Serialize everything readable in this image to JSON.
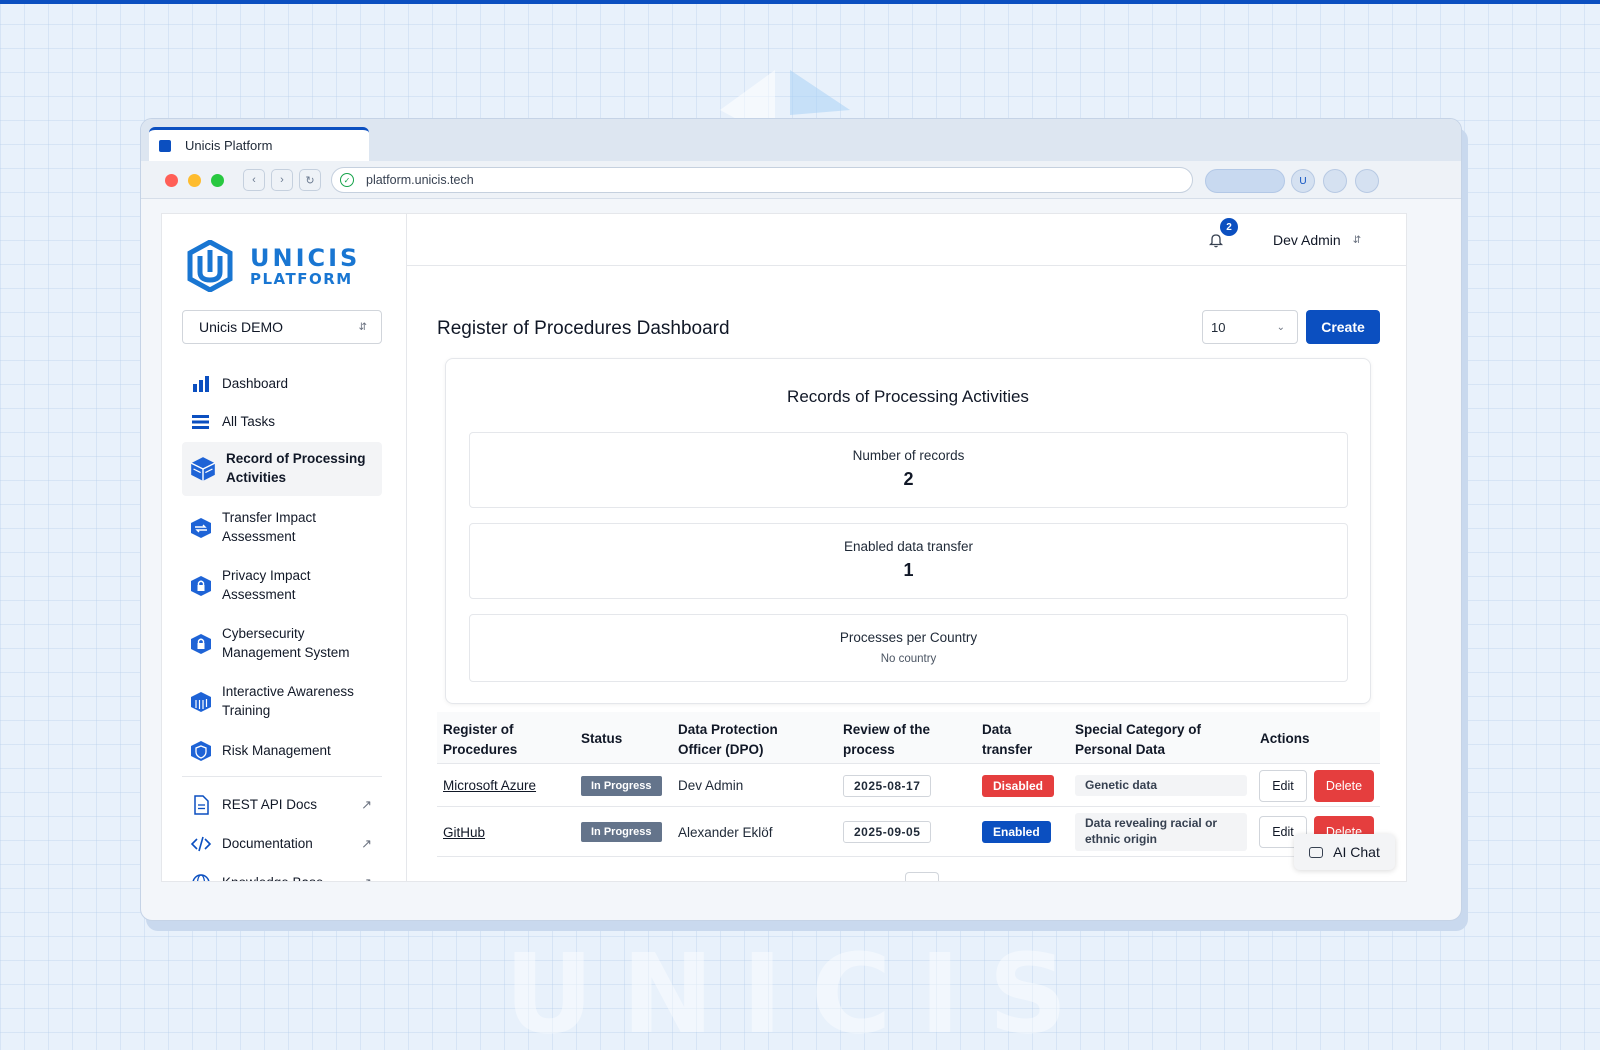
{
  "browser": {
    "tab_title": "Unicis Platform",
    "url": "platform.unicis.tech",
    "profile_initial": "U"
  },
  "background": {
    "watermark": "UNICIS"
  },
  "sidebar": {
    "logo_line1": "UNICIS",
    "logo_line2": "PLATFORM",
    "org_select": "Unicis DEMO",
    "items": [
      {
        "label": "Dashboard",
        "icon": "bar-chart-icon"
      },
      {
        "label": "All Tasks",
        "icon": "list-icon"
      },
      {
        "label": "Record of Processing Activities",
        "icon": "cube-stack-icon",
        "active": true
      },
      {
        "label": "Transfer Impact Assessment",
        "icon": "transfer-cube-icon"
      },
      {
        "label": "Privacy Impact Assessment",
        "icon": "lock-hexagon-icon"
      },
      {
        "label": "Cybersecurity Management System",
        "icon": "lock-hexagon-icon"
      },
      {
        "label": "Interactive Awareness Training",
        "icon": "building-cube-icon"
      },
      {
        "label": "Risk Management",
        "icon": "shield-hexagon-icon"
      }
    ],
    "external_links": [
      {
        "label": "REST API Docs",
        "icon": "document-icon"
      },
      {
        "label": "Documentation",
        "icon": "code-icon"
      },
      {
        "label": "Knowledge Base",
        "icon": "globe-icon"
      }
    ]
  },
  "header": {
    "notification_count": "2",
    "user_name": "Dev Admin"
  },
  "main": {
    "title": "Register of Procedures Dashboard",
    "page_size": "10",
    "create_label": "Create",
    "card_title": "Records of Processing Activities",
    "stats": [
      {
        "label": "Number of records",
        "value": "2"
      },
      {
        "label": "Enabled data transfer",
        "value": "1"
      },
      {
        "label": "Processes per Country",
        "value": "No country"
      }
    ],
    "table": {
      "headers": [
        "Register of Procedures",
        "Status",
        "Data Protection Officer (DPO)",
        "Review of the process",
        "Data transfer",
        "Special Category of Personal Data",
        "Actions"
      ],
      "rows": [
        {
          "name": "Microsoft Azure",
          "status": "In Progress",
          "dpo": "Dev Admin",
          "review": "2025-08-17",
          "transfer": "Disabled",
          "category": "Genetic data",
          "edit": "Edit",
          "delete": "Delete"
        },
        {
          "name": "GitHub",
          "status": "In Progress",
          "dpo": "Alexander Eklöf",
          "review": "2025-09-05",
          "transfer": "Enabled",
          "category": "Data revealing racial or ethnic origin",
          "edit": "Edit",
          "delete": "Delete"
        }
      ]
    },
    "ai_chat_label": "AI Chat"
  },
  "colors": {
    "brand": "#0b4fc0",
    "logo": "#1976d2",
    "danger": "#e53e3e",
    "status_gray": "#64748b"
  }
}
